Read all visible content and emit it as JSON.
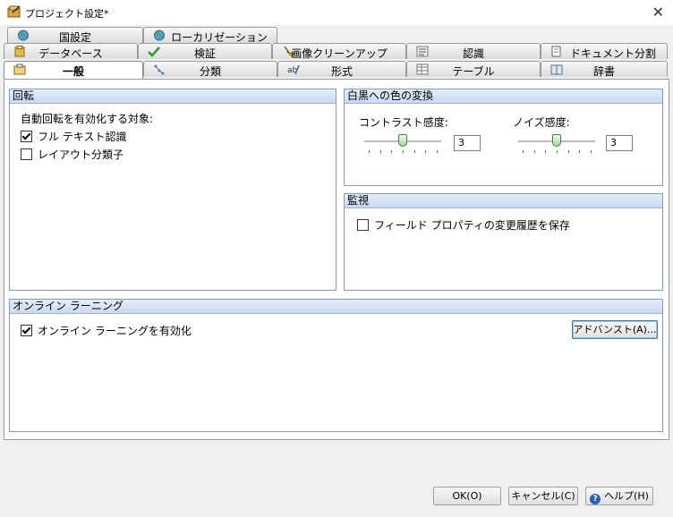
{
  "window": {
    "title": "プロジェクト設定*",
    "close_symbol": "✕"
  },
  "tabs": {
    "row1": [
      {
        "label": "国設定",
        "icon": "globe-icon"
      },
      {
        "label": "ローカリゼーション",
        "icon": "globe-icon"
      }
    ],
    "row2": [
      {
        "label": "データベース",
        "icon": "database-icon"
      },
      {
        "label": "検証",
        "icon": "checkmark-icon"
      },
      {
        "label": "画像クリーンアップ",
        "icon": "broom-icon"
      },
      {
        "label": "認識",
        "icon": "recognition-icon"
      },
      {
        "label": "ドキュメント分割",
        "icon": "document-split-icon"
      }
    ],
    "row3": [
      {
        "label": "一般",
        "icon": "general-icon",
        "active": true
      },
      {
        "label": "分類",
        "icon": "classification-icon"
      },
      {
        "label": "形式",
        "icon": "format-icon"
      },
      {
        "label": "テーブル",
        "icon": "table-icon"
      },
      {
        "label": "辞書",
        "icon": "dictionary-icon"
      }
    ]
  },
  "rotation": {
    "header": "回転",
    "subtitle": "自動回転を有効化する対象:",
    "fulltext_label": "フル テキスト認識",
    "fulltext_checked": true,
    "layout_label": "レイアウト分類子",
    "layout_checked": false
  },
  "binarization": {
    "header": "白黒への色の変換",
    "contrast_label": "コントラスト感度:",
    "contrast_value": "3",
    "contrast_fraction": 0.5,
    "noise_label": "ノイズ感度:",
    "noise_value": "3",
    "noise_fraction": 0.5
  },
  "monitoring": {
    "header": "監視",
    "save_history_label": "フィールド プロパティの変更履歴を保存",
    "save_history_checked": false
  },
  "online_learning": {
    "header": "オンライン ラーニング",
    "enable_label": "オンライン ラーニングを有効化",
    "enable_checked": true,
    "advanced_button": "アドバンスト(A)..."
  },
  "footer": {
    "ok_label": "OK(O)",
    "cancel_label": "キャンセル(C)",
    "help_label": "ヘルプ(H)"
  }
}
